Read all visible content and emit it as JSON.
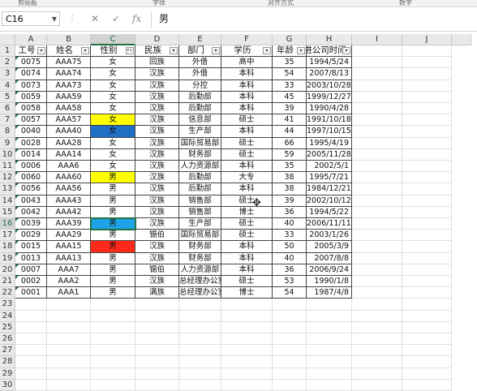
{
  "ribbon": {
    "labels": [
      "剪贴板",
      "字体",
      "对齐方式",
      "数字"
    ]
  },
  "formula_bar": {
    "name_box": "C16",
    "formula_value": "男",
    "fx_label": "fx",
    "cancel_label": "✕",
    "enter_label": "✓"
  },
  "columns": [
    "A",
    "B",
    "C",
    "D",
    "E",
    "F",
    "G",
    "H",
    "I",
    "J"
  ],
  "rows": [
    "1",
    "2",
    "3",
    "4",
    "5",
    "6",
    "7",
    "8",
    "9",
    "10",
    "11",
    "12",
    "13",
    "14",
    "15",
    "16",
    "17",
    "18",
    "19",
    "20",
    "21",
    "22",
    "23",
    "24",
    "25",
    "26",
    "27",
    "28",
    "29",
    "30"
  ],
  "table": {
    "headers": [
      "工号",
      "姓名",
      "性别",
      "民族",
      "部门",
      "学历",
      "年龄",
      "进公司时间"
    ],
    "records": [
      [
        "0075",
        "AAA75",
        "女",
        "回族",
        "外借",
        "高中",
        "35",
        "1994/5/24"
      ],
      [
        "0074",
        "AAA74",
        "女",
        "汉族",
        "外借",
        "本科",
        "54",
        "2007/8/13"
      ],
      [
        "0073",
        "AAA73",
        "女",
        "汉族",
        "分控",
        "本科",
        "33",
        "2003/10/28"
      ],
      [
        "0059",
        "AAA59",
        "女",
        "汉族",
        "后勤部",
        "本科",
        "45",
        "1999/12/27"
      ],
      [
        "0058",
        "AAA58",
        "女",
        "汉族",
        "后勤部",
        "本科",
        "39",
        "1990/4/28"
      ],
      [
        "0057",
        "AAA57",
        "女",
        "汉族",
        "信息部",
        "硕士",
        "41",
        "1991/10/18"
      ],
      [
        "0040",
        "AAA40",
        "女",
        "汉族",
        "生产部",
        "本科",
        "44",
        "1997/10/15"
      ],
      [
        "0028",
        "AAA28",
        "女",
        "汉族",
        "国际贸易部",
        "硕士",
        "66",
        "1995/4/19"
      ],
      [
        "0014",
        "AAA14",
        "女",
        "汉族",
        "财务部",
        "硕士",
        "59",
        "2005/11/28"
      ],
      [
        "0006",
        "AAA6",
        "女",
        "汉族",
        "人力资源部",
        "本科",
        "35",
        "2002/5/1"
      ],
      [
        "0060",
        "AAA60",
        "男",
        "汉族",
        "后勤部",
        "大专",
        "38",
        "1995/7/21"
      ],
      [
        "0056",
        "AAA56",
        "男",
        "汉族",
        "后勤部",
        "本科",
        "38",
        "1984/12/21"
      ],
      [
        "0043",
        "AAA43",
        "男",
        "汉族",
        "销售部",
        "硕士",
        "39",
        "2002/10/12"
      ],
      [
        "0042",
        "AAA42",
        "男",
        "汉族",
        "销售部",
        "博士",
        "36",
        "1994/5/22"
      ],
      [
        "0039",
        "AAA39",
        "男",
        "汉族",
        "生产部",
        "硕士",
        "40",
        "2006/11/11"
      ],
      [
        "0029",
        "AAA29",
        "男",
        "锡伯",
        "国际贸易部",
        "硕士",
        "33",
        "2003/1/26"
      ],
      [
        "0015",
        "AAA15",
        "男",
        "汉族",
        "财务部",
        "本科",
        "50",
        "2005/3/9"
      ],
      [
        "0013",
        "AAA13",
        "男",
        "汉族",
        "财务部",
        "本科",
        "40",
        "2007/8/8"
      ],
      [
        "0007",
        "AAA7",
        "男",
        "锡伯",
        "人力资源部",
        "本科",
        "36",
        "2006/9/24"
      ],
      [
        "0002",
        "AAA2",
        "男",
        "汉族",
        "总经理办公室",
        "硕士",
        "53",
        "1990/1/8"
      ],
      [
        "0001",
        "AAA1",
        "男",
        "满族",
        "总经理办公室",
        "博士",
        "54",
        "1987/4/8"
      ]
    ]
  },
  "cell_fills": {
    "yellow": "#ffff00",
    "blue": "#1f6fc5",
    "lightblue": "#1fa3e6",
    "red": "#ff2a1a"
  },
  "filled_cells": [
    {
      "row": 7,
      "color": "yellow"
    },
    {
      "row": 8,
      "color": "blue"
    },
    {
      "row": 12,
      "color": "yellow"
    },
    {
      "row": 16,
      "color": "lightblue"
    },
    {
      "row": 18,
      "color": "red"
    }
  ],
  "selected_cell": "C16",
  "filter_icons": {
    "default": "filter-dropdown-icon",
    "sorted": "sort-ascending-filter-icon"
  }
}
